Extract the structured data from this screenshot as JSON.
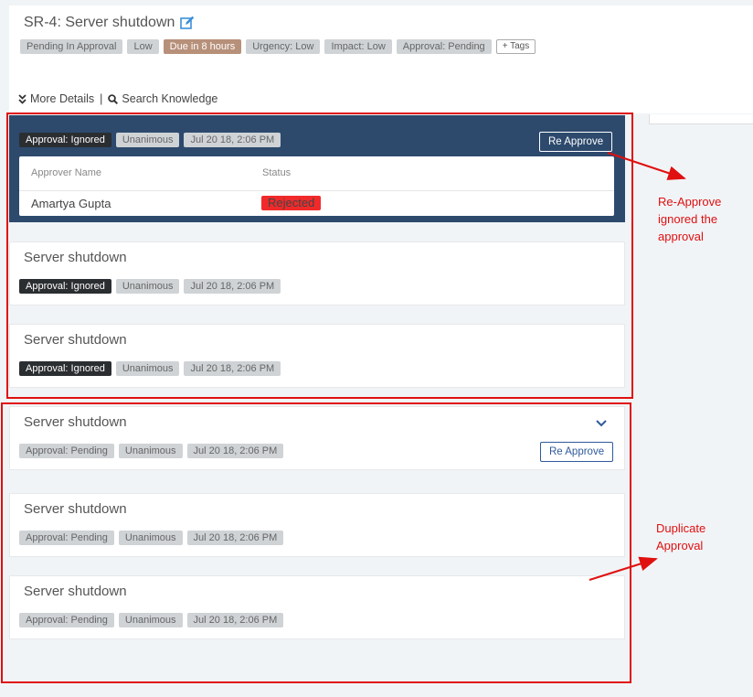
{
  "ticket": {
    "title": "SR-4: Server shutdown",
    "tags": [
      "Pending In Approval",
      "Low",
      "Due in 8 hours",
      "Urgency: Low",
      "Impact: Low",
      "Approval: Pending"
    ],
    "add_tags_label": "+ Tags",
    "more_details_label": "More Details",
    "separator": "|",
    "search_knowledge_label": "Search Knowledge"
  },
  "approvals": {
    "expanded": {
      "chips": [
        "Approval: Ignored",
        "Unanimous",
        "Jul 20 18, 2:06 PM"
      ],
      "reapprove_label": "Re Approve",
      "columns": [
        "Approver Name",
        "Status"
      ],
      "row": {
        "name": "Amartya Gupta",
        "status": "Rejected"
      }
    },
    "ignored_cards": [
      {
        "title": "Server shutdown",
        "chips": [
          "Approval: Ignored",
          "Unanimous",
          "Jul 20 18, 2:06 PM"
        ]
      },
      {
        "title": "Server shutdown",
        "chips": [
          "Approval: Ignored",
          "Unanimous",
          "Jul 20 18, 2:06 PM"
        ]
      }
    ],
    "pending_cards": [
      {
        "title": "Server shutdown",
        "chips": [
          "Approval: Pending",
          "Unanimous",
          "Jul 20 18, 2:06 PM"
        ],
        "reapprove_label": "Re Approve"
      },
      {
        "title": "Server shutdown",
        "chips": [
          "Approval: Pending",
          "Unanimous",
          "Jul 20 18, 2:06 PM"
        ]
      },
      {
        "title": "Server shutdown",
        "chips": [
          "Approval: Pending",
          "Unanimous",
          "Jul 20 18, 2:06 PM"
        ]
      }
    ]
  },
  "annotations": {
    "reapprove_note": "Re-Approve\nignored the\napproval",
    "duplicate_note": "Duplicate\nApproval"
  },
  "colors": {
    "annotation": "#e01010",
    "dark_card": "#2d4a6d",
    "rejected": "#f02a2a",
    "due": "#b7907a",
    "link_blue": "#2f5a9c"
  },
  "icons": [
    "edit-icon",
    "double-chevron-down-icon",
    "search-icon",
    "chevron-down-icon"
  ]
}
